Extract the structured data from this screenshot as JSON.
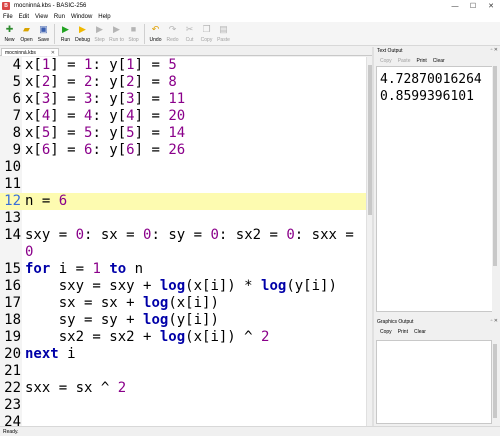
{
  "window": {
    "title": "mocninná.kbs - BASIC-256",
    "controls": {
      "minimize": "—",
      "maximize": "☐",
      "close": "✕"
    }
  },
  "menu": [
    "File",
    "Edit",
    "View",
    "Run",
    "Window",
    "Help"
  ],
  "toolbar": [
    {
      "name": "new",
      "label": "New",
      "icon": "new-file-icon",
      "glyph": "✚",
      "color": "#2e8b2e",
      "enabled": true
    },
    {
      "name": "open",
      "label": "Open",
      "icon": "folder-icon",
      "glyph": "▰",
      "color": "#d9a400",
      "enabled": true
    },
    {
      "name": "save",
      "label": "Save",
      "icon": "floppy-icon",
      "glyph": "▣",
      "color": "#3a5fb0",
      "enabled": true
    },
    {
      "sep": true
    },
    {
      "name": "run",
      "label": "Run",
      "icon": "play-icon",
      "glyph": "▶",
      "color": "#22a322",
      "enabled": true
    },
    {
      "name": "debug",
      "label": "Debug",
      "icon": "debug-icon",
      "glyph": "▶",
      "color": "#f0b800",
      "enabled": true
    },
    {
      "name": "step",
      "label": "Step",
      "icon": "step-icon",
      "glyph": "▶",
      "color": "#b5b5b5",
      "enabled": false
    },
    {
      "name": "run-to",
      "label": "Run to",
      "icon": "run-to-icon",
      "glyph": "▶",
      "color": "#b5b5b5",
      "enabled": false
    },
    {
      "name": "stop",
      "label": "Stop",
      "icon": "stop-icon",
      "glyph": "■",
      "color": "#b5b5b5",
      "enabled": false
    },
    {
      "sep": true
    },
    {
      "name": "undo",
      "label": "Undo",
      "icon": "undo-icon",
      "glyph": "↶",
      "color": "#e0a000",
      "enabled": true
    },
    {
      "name": "redo",
      "label": "Redo",
      "icon": "redo-icon",
      "glyph": "↷",
      "color": "#b5b5b5",
      "enabled": false
    },
    {
      "name": "cut",
      "label": "Cut",
      "icon": "scissors-icon",
      "glyph": "✂",
      "color": "#b5b5b5",
      "enabled": false
    },
    {
      "name": "copy",
      "label": "Copy",
      "icon": "copy-icon",
      "glyph": "❐",
      "color": "#b5b5b5",
      "enabled": false
    },
    {
      "name": "paste",
      "label": "Paste",
      "icon": "paste-icon",
      "glyph": "▤",
      "color": "#b5b5b5",
      "enabled": false
    }
  ],
  "editor": {
    "tab_label": "mocninná.kbs",
    "tab_close": "✕",
    "highlighted_line": 12,
    "lines": [
      {
        "n": "4",
        "segs": [
          [
            "x[",
            "t"
          ],
          [
            "1",
            "n"
          ],
          [
            "] = ",
            "t"
          ],
          [
            "1",
            "n"
          ],
          [
            ": y[",
            "t"
          ],
          [
            "1",
            "n"
          ],
          [
            "] = ",
            "t"
          ],
          [
            "5",
            "n"
          ]
        ]
      },
      {
        "n": "5",
        "segs": [
          [
            "x[",
            "t"
          ],
          [
            "2",
            "n"
          ],
          [
            "] = ",
            "t"
          ],
          [
            "2",
            "n"
          ],
          [
            ": y[",
            "t"
          ],
          [
            "2",
            "n"
          ],
          [
            "] = ",
            "t"
          ],
          [
            "8",
            "n"
          ]
        ]
      },
      {
        "n": "6",
        "segs": [
          [
            "x[",
            "t"
          ],
          [
            "3",
            "n"
          ],
          [
            "] = ",
            "t"
          ],
          [
            "3",
            "n"
          ],
          [
            ": y[",
            "t"
          ],
          [
            "3",
            "n"
          ],
          [
            "] = ",
            "t"
          ],
          [
            "11",
            "n"
          ]
        ]
      },
      {
        "n": "7",
        "segs": [
          [
            "x[",
            "t"
          ],
          [
            "4",
            "n"
          ],
          [
            "] = ",
            "t"
          ],
          [
            "4",
            "n"
          ],
          [
            ": y[",
            "t"
          ],
          [
            "4",
            "n"
          ],
          [
            "] = ",
            "t"
          ],
          [
            "20",
            "n"
          ]
        ]
      },
      {
        "n": "8",
        "segs": [
          [
            "x[",
            "t"
          ],
          [
            "5",
            "n"
          ],
          [
            "] = ",
            "t"
          ],
          [
            "5",
            "n"
          ],
          [
            ": y[",
            "t"
          ],
          [
            "5",
            "n"
          ],
          [
            "] = ",
            "t"
          ],
          [
            "14",
            "n"
          ]
        ]
      },
      {
        "n": "9",
        "segs": [
          [
            "x[",
            "t"
          ],
          [
            "6",
            "n"
          ],
          [
            "] = ",
            "t"
          ],
          [
            "6",
            "n"
          ],
          [
            ": y[",
            "t"
          ],
          [
            "6",
            "n"
          ],
          [
            "] = ",
            "t"
          ],
          [
            "26",
            "n"
          ]
        ]
      },
      {
        "n": "10",
        "segs": []
      },
      {
        "n": "11",
        "segs": []
      },
      {
        "n": "12",
        "segs": [
          [
            "n = ",
            "t"
          ],
          [
            "6",
            "n"
          ]
        ]
      },
      {
        "n": "13",
        "segs": []
      },
      {
        "n": "14",
        "segs": [
          [
            "sxy = ",
            "t"
          ],
          [
            "0",
            "n"
          ],
          [
            ": sx = ",
            "t"
          ],
          [
            "0",
            "n"
          ],
          [
            ": sy = ",
            "t"
          ],
          [
            "0",
            "n"
          ],
          [
            ": sx2 = ",
            "t"
          ],
          [
            "0",
            "n"
          ],
          [
            ": sxx =",
            "t"
          ]
        ]
      },
      {
        "n": "",
        "segs": [
          [
            "0",
            "n"
          ]
        ]
      },
      {
        "n": "15",
        "segs": [
          [
            "for",
            "k"
          ],
          [
            " i = ",
            "t"
          ],
          [
            "1",
            "n"
          ],
          [
            " ",
            "t"
          ],
          [
            "to",
            "k"
          ],
          [
            " n",
            "t"
          ]
        ]
      },
      {
        "n": "16",
        "segs": [
          [
            "    sxy = sxy + ",
            "t"
          ],
          [
            "log",
            "k"
          ],
          [
            "(x[i]) * ",
            "t"
          ],
          [
            "log",
            "k"
          ],
          [
            "(y[i])",
            "t"
          ]
        ]
      },
      {
        "n": "17",
        "segs": [
          [
            "    sx = sx + ",
            "t"
          ],
          [
            "log",
            "k"
          ],
          [
            "(x[i])",
            "t"
          ]
        ]
      },
      {
        "n": "18",
        "segs": [
          [
            "    sy = sy + ",
            "t"
          ],
          [
            "log",
            "k"
          ],
          [
            "(y[i])",
            "t"
          ]
        ]
      },
      {
        "n": "19",
        "segs": [
          [
            "    sx2 = sx2 + ",
            "t"
          ],
          [
            "log",
            "k"
          ],
          [
            "(x[i]) ^ ",
            "t"
          ],
          [
            "2",
            "n"
          ]
        ]
      },
      {
        "n": "20",
        "segs": [
          [
            "next",
            "k"
          ],
          [
            " i",
            "t"
          ]
        ]
      },
      {
        "n": "21",
        "segs": []
      },
      {
        "n": "22",
        "segs": [
          [
            "sxx = sx ^ ",
            "t"
          ],
          [
            "2",
            "n"
          ]
        ]
      },
      {
        "n": "23",
        "segs": []
      },
      {
        "n": "24",
        "segs": []
      }
    ]
  },
  "text_output": {
    "title": "Text Output",
    "buttons": [
      {
        "label": "Copy",
        "enabled": false
      },
      {
        "label": "Paste",
        "enabled": false
      },
      {
        "label": "Print",
        "enabled": true
      },
      {
        "label": "Clear",
        "enabled": true
      }
    ],
    "lines": [
      "4.72870016264",
      "0.8599396101"
    ]
  },
  "graphics_output": {
    "title": "Graphics Output",
    "buttons": [
      {
        "label": "Copy",
        "enabled": true
      },
      {
        "label": "Print",
        "enabled": true
      },
      {
        "label": "Clear",
        "enabled": true
      }
    ]
  },
  "panel_buttons": "▫ ✕",
  "status": "Ready."
}
